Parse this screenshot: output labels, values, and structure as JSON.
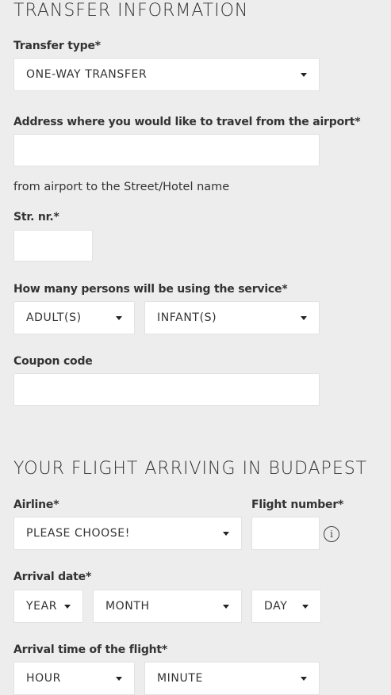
{
  "transfer": {
    "title": "TRANSFER INFORMATION",
    "transfer_type_label": "Transfer type*",
    "transfer_type_value": "ONE-WAY TRANSFER",
    "address_label": "Address where you would like to travel from the airport*",
    "address_value": "",
    "address_hint": "from airport to the Street/Hotel name",
    "str_nr_label": "Str. nr.*",
    "str_nr_value": "",
    "persons_label": "How many persons will be using the service*",
    "adults_value": "ADULT(S)",
    "infants_value": "INFANT(S)",
    "coupon_label": "Coupon code",
    "coupon_value": ""
  },
  "flight": {
    "title": "YOUR FLIGHT ARRIVING IN BUDAPEST",
    "airline_label": "Airline*",
    "airline_value": "PLEASE CHOOSE!",
    "flight_number_label": "Flight number*",
    "flight_number_value": "",
    "info_icon_glyph": "i",
    "arrival_date_label": "Arrival date*",
    "year_value": "YEAR",
    "month_value": "MONTH",
    "day_value": "DAY",
    "arrival_time_label": "Arrival time of the flight*",
    "hour_value": "HOUR",
    "minute_value": "MINUTE"
  },
  "icons": {
    "dropdown": "caret-down-icon",
    "info": "info-icon"
  },
  "colors": {
    "page_background": "#ededed",
    "field_background": "#ffffff",
    "text": "#333333"
  }
}
